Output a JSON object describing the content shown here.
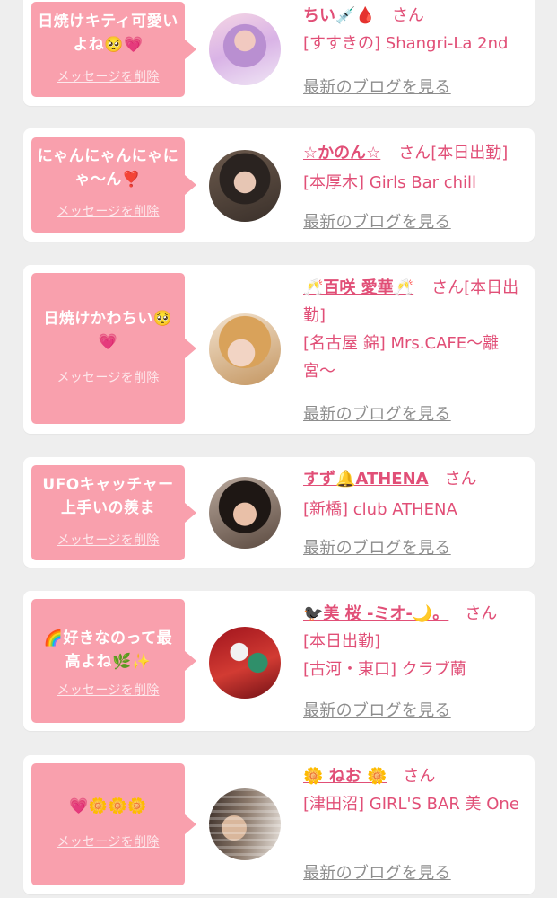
{
  "common": {
    "delete_label": "メッセージを削除",
    "blog_label": "最新のブログを見る",
    "san": "さん"
  },
  "colors": {
    "bubble": "#f9a0ad",
    "accent": "#e14f77",
    "link_gray": "#8d8d8d"
  },
  "items": [
    {
      "message": "日焼けキティ可愛いよね🥺💗",
      "name": "ちい💉🩸",
      "extra": "",
      "location": "[すすきの] Shangri-La 2nd"
    },
    {
      "message": "にゃんにゃんにゃにゃ〜ん❣️",
      "name": "☆かのん☆",
      "extra": "[本日出勤]",
      "location": "[本厚木] Girls Bar chill"
    },
    {
      "message": "日焼けかわちい🥺💗",
      "name": "🥂百咲 愛華🥂",
      "extra": "[本日出勤]",
      "location": "[名古屋 錦] Mrs.CAFE〜離宮〜"
    },
    {
      "message": "UFOキャッチャー上手いの羨ま",
      "name": "すず🔔ATHENA",
      "extra": "",
      "location": "[新橋] club ATHENA"
    },
    {
      "message": "🌈好きなのって最高よね🌿✨",
      "name": "🐦‍⬛美 桜 -ミオ-🌙。",
      "extra": "[本日出勤]",
      "location": "[古河・東口] クラブ蘭"
    },
    {
      "message": "💗🌼🌼🌼",
      "name": "🌼 ねお 🌼",
      "extra": "",
      "location": "[津田沼] GIRL'S BAR 美 One"
    }
  ]
}
